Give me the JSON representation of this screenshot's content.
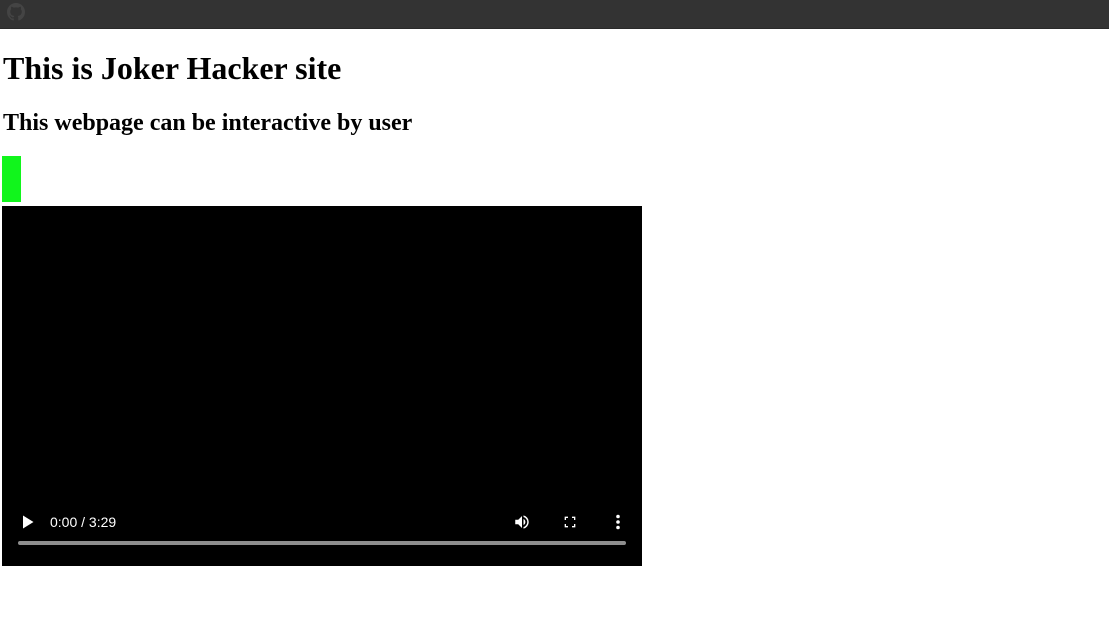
{
  "header": {
    "icon": "github-icon"
  },
  "main": {
    "title": "This is Joker Hacker site",
    "subtitle": "This webpage can be interactive by user",
    "accent_color": "#11f51c"
  },
  "video": {
    "time_display": "0:00 / 3:29",
    "progress": 0,
    "controls": {
      "play_icon": "play-icon",
      "volume_icon": "volume-icon",
      "fullscreen_icon": "fullscreen-icon",
      "more_icon": "more-vertical-icon"
    }
  }
}
